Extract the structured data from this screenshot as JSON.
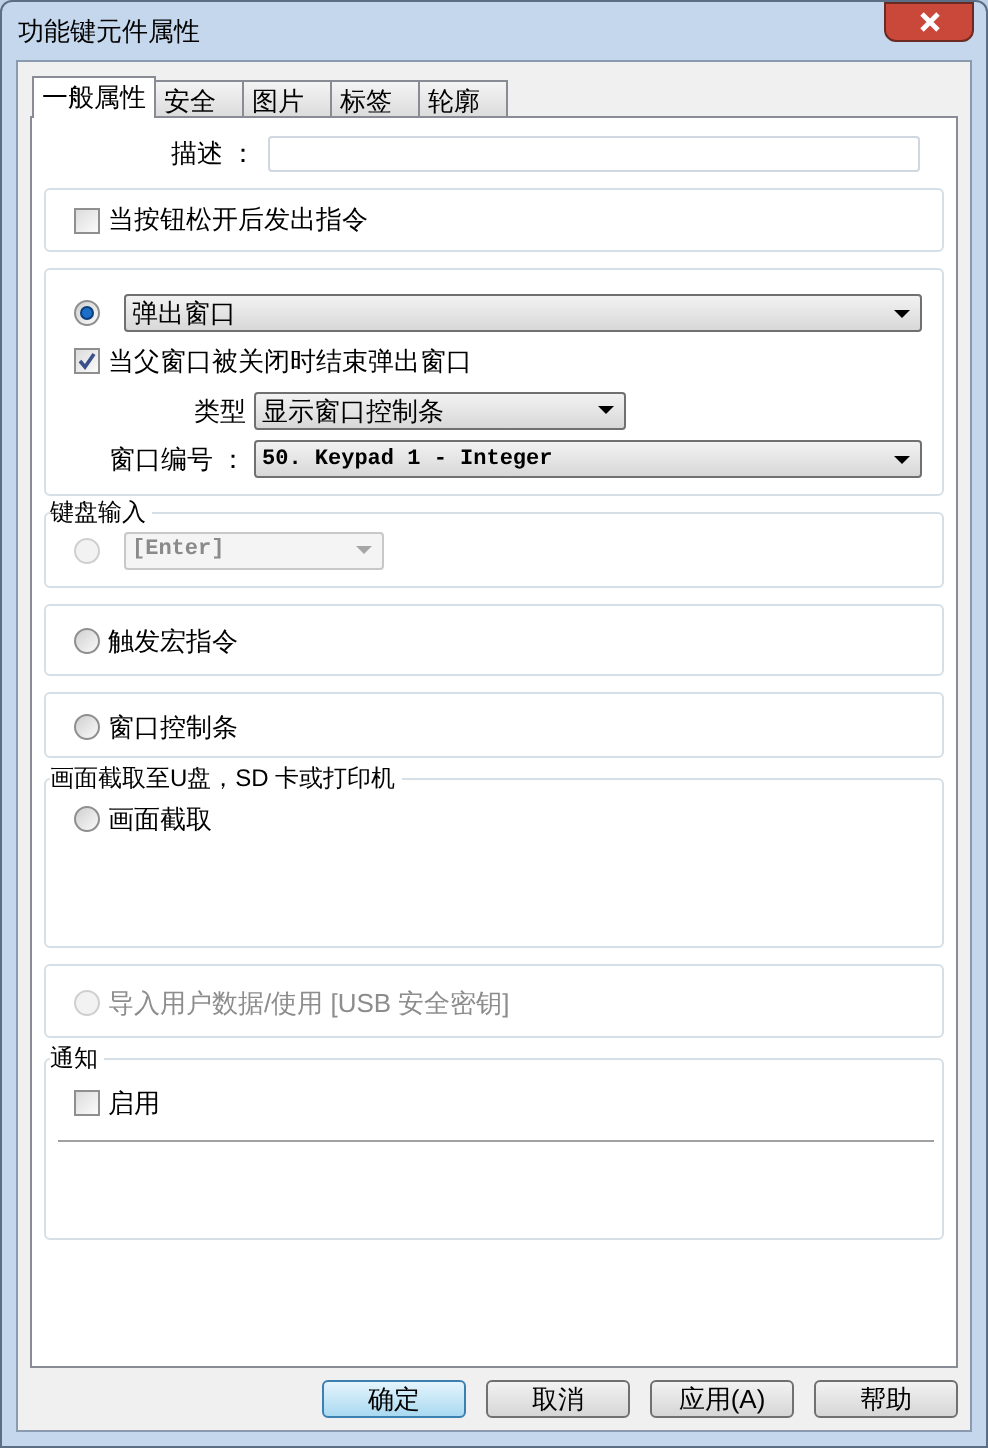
{
  "window": {
    "title": "功能键元件属性"
  },
  "tabs": [
    {
      "label": "一般属性",
      "selected": true
    },
    {
      "label": "安全",
      "selected": false
    },
    {
      "label": "图片",
      "selected": false
    },
    {
      "label": "标签",
      "selected": false
    },
    {
      "label": "轮廓",
      "selected": false
    }
  ],
  "description": {
    "label": "描述 ："
  },
  "release_option": {
    "label": "当按钮松开后发出指令",
    "checked": false
  },
  "popup": {
    "selected": true,
    "action": "弹出窗口",
    "close_with_parent": {
      "label": "当父窗口被关闭时结束弹出窗口",
      "checked": true
    },
    "type": {
      "label": "类型",
      "value": "显示窗口控制条"
    },
    "window_number": {
      "label": "窗口编号 ：",
      "value": "50. Keypad 1 - Integer"
    }
  },
  "keyboard_input": {
    "title": "键盘输入",
    "selected": false,
    "disabled": true,
    "value": "[Enter]"
  },
  "macro": {
    "label": "触发宏指令",
    "selected": false,
    "disabled": false
  },
  "window_bar": {
    "label": "窗口控制条",
    "selected": false,
    "disabled": false
  },
  "screen_capture": {
    "title": "画面截取至U盘，SD 卡或打印机",
    "label": "画面截取",
    "selected": false,
    "disabled": false
  },
  "import_data": {
    "label": "导入用户数据/使用 [USB 安全密钥]",
    "selected": false,
    "disabled": true
  },
  "notification": {
    "title": "通知",
    "enable": {
      "label": "启用",
      "checked": false
    }
  },
  "buttons": [
    {
      "label": "确定",
      "default": true
    },
    {
      "label": "取消",
      "default": false
    },
    {
      "label": "应用(A)",
      "default": false
    },
    {
      "label": "帮助",
      "default": false
    }
  ]
}
